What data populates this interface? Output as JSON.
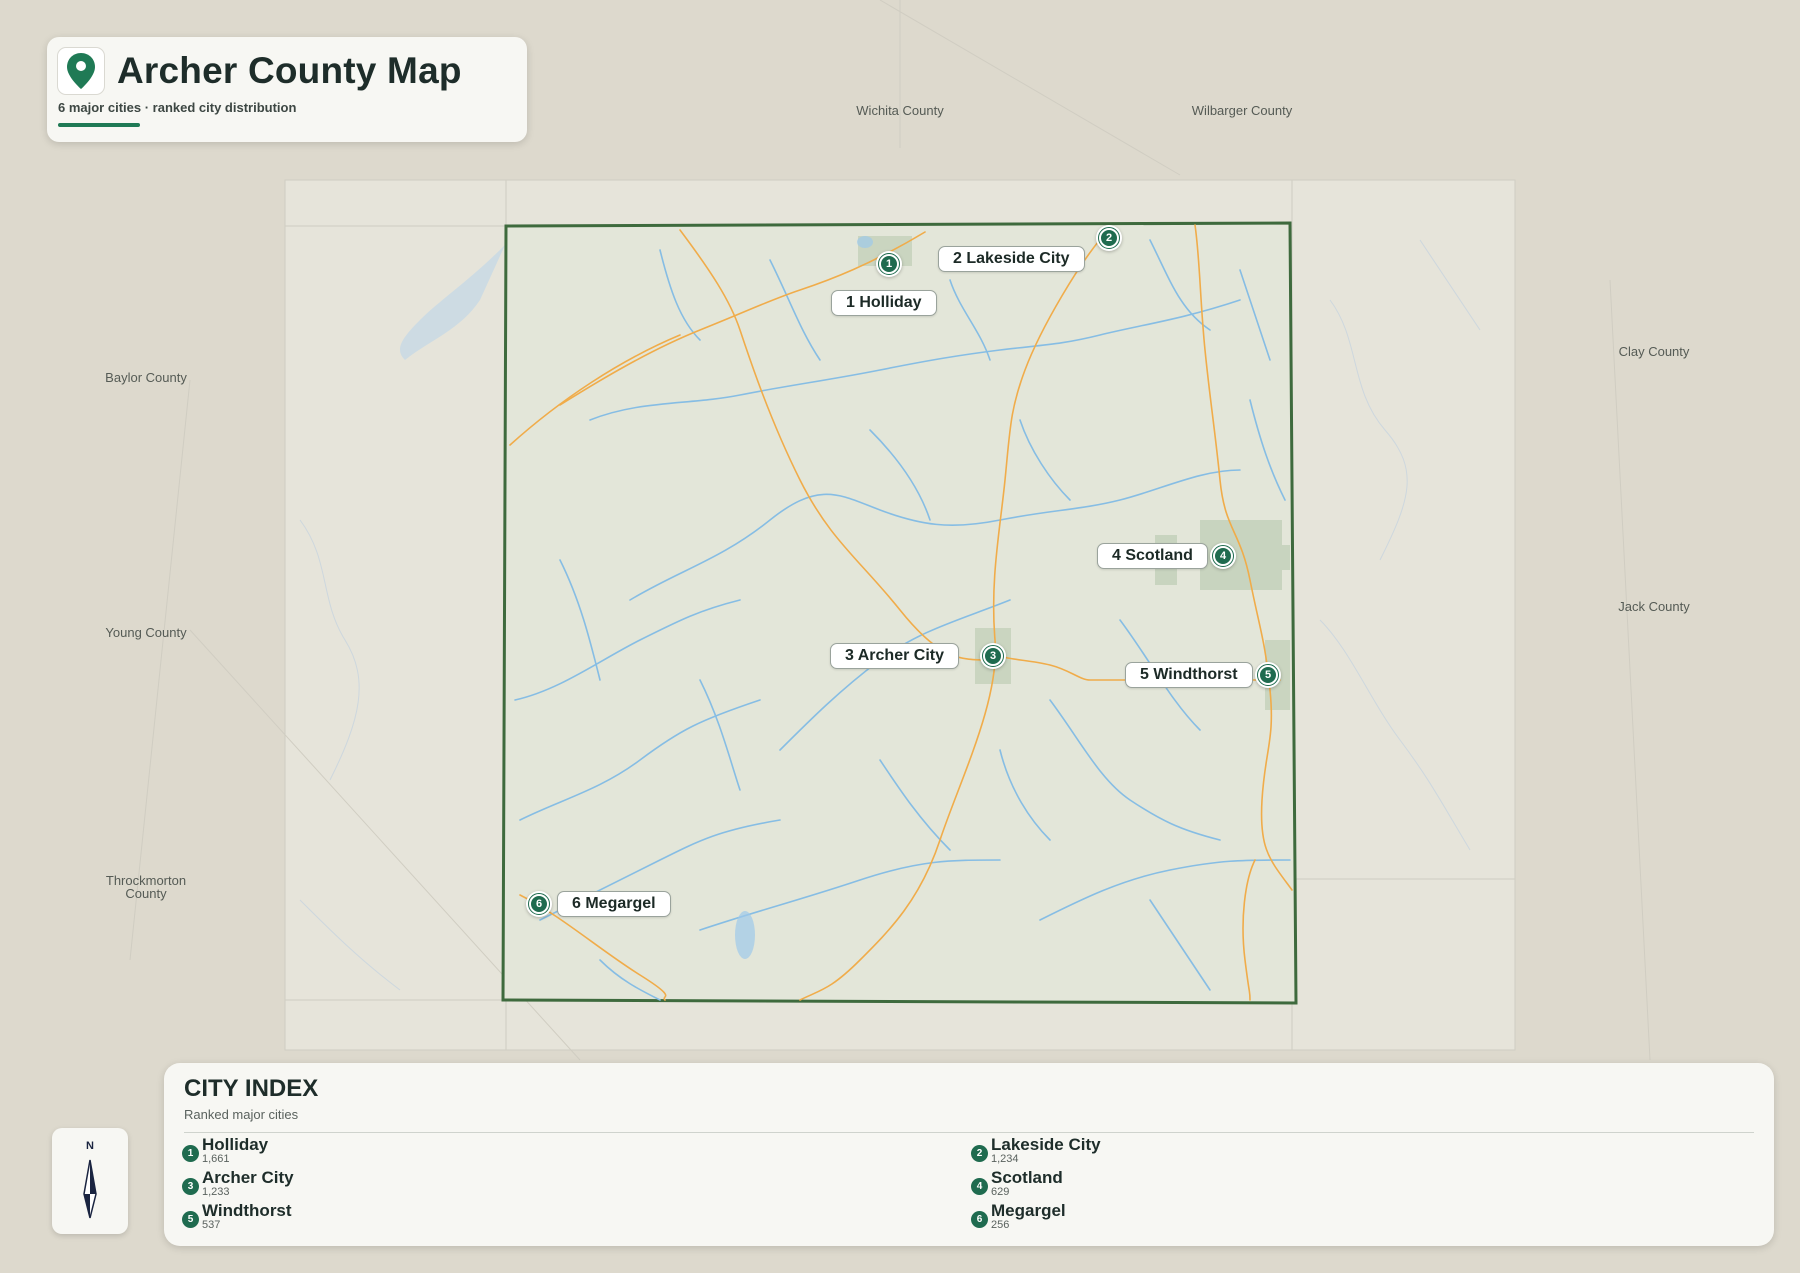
{
  "header": {
    "title": "Archer County Map",
    "subtitle": "6 major cities · ranked city distribution",
    "icon": "map-pin-icon"
  },
  "neighbors": [
    "Wichita County",
    "Wilbarger County",
    "Clay County",
    "Baylor County",
    "Jack County",
    "Young County",
    "Throckmorton County"
  ],
  "cities": [
    {
      "rank": "1",
      "label": "1 Holliday",
      "name": "Holliday",
      "population": "1,661"
    },
    {
      "rank": "2",
      "label": "2 Lakeside City",
      "name": "Lakeside City",
      "population": "1,234"
    },
    {
      "rank": "3",
      "label": "3 Archer City",
      "name": "Archer City",
      "population": "1,233"
    },
    {
      "rank": "4",
      "label": "4 Scotland",
      "name": "Scotland",
      "population": "629"
    },
    {
      "rank": "5",
      "label": "5 Windthorst",
      "name": "Windthorst",
      "population": "537"
    },
    {
      "rank": "6",
      "label": "6 Megargel",
      "name": "Megargel",
      "population": "256"
    }
  ],
  "index": {
    "title": "CITY INDEX",
    "subtitle": "Ranked major cities"
  },
  "compass": {
    "north_label": "N",
    "icon": "north-arrow-icon"
  },
  "colors": {
    "accent": "#1f6b4f",
    "county_fill": "#e3e6d9",
    "county_border": "#3e6a3d",
    "water": "#7fb8e2",
    "roads": "#f0ac4a",
    "background": "#ddd9cd"
  }
}
